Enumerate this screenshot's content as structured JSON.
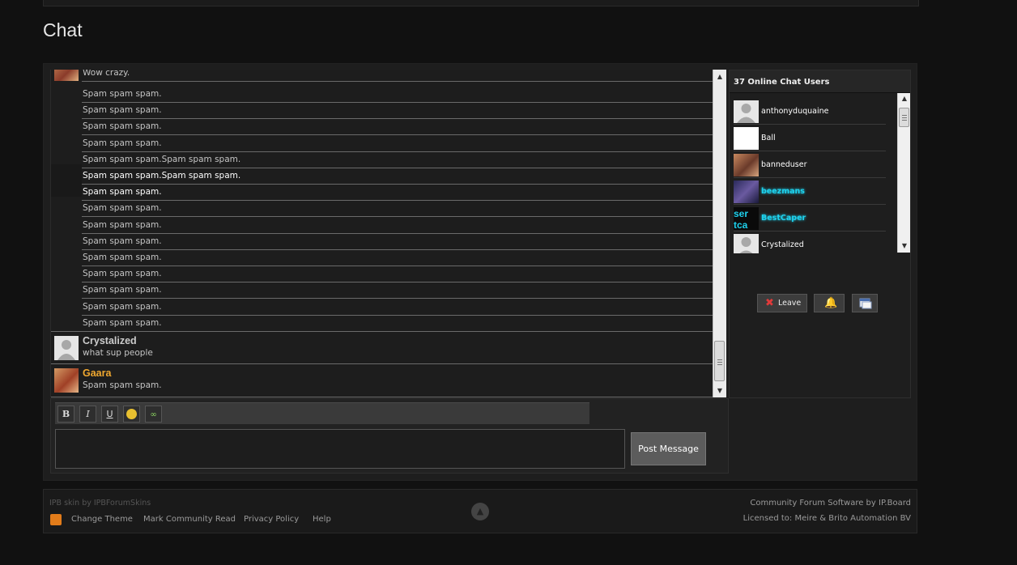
{
  "page": {
    "title": "Chat"
  },
  "messages": {
    "partial_top": "Wow crazy.",
    "lines": [
      "Spam spam spam.",
      "Spam spam spam.",
      "Spam spam spam.",
      "Spam spam spam.",
      "Spam spam spam.Spam spam spam.",
      "Spam spam spam.Spam spam spam.",
      "Spam spam spam.",
      "Spam spam spam.",
      "Spam spam spam.",
      "Spam spam spam.",
      "Spam spam spam.",
      "Spam spam spam.",
      "Spam spam spam.",
      "Spam spam spam.",
      "Spam spam spam."
    ],
    "blocks": [
      {
        "name": "Crystalized",
        "text": "what sup people",
        "name_color": "#cccccc"
      },
      {
        "name": "Gaara",
        "text": "Spam spam spam.",
        "name_color": "#f0a830"
      }
    ]
  },
  "users": {
    "header": "37 Online Chat Users",
    "list": [
      {
        "name": "anthonyduquaine",
        "avatar": "default-avatar-icon"
      },
      {
        "name": "Ball",
        "avatar": "white-avatar-icon"
      },
      {
        "name": "banneduser",
        "avatar": "photo-avatar-icon"
      },
      {
        "name": "beezmans",
        "avatar": "purple-avatar-icon",
        "moderator": true
      },
      {
        "name": "BestCaper",
        "avatar": "cyan-text-avatar-icon",
        "moderator": true
      },
      {
        "name": "Crystalized",
        "avatar": "default-avatar-icon"
      }
    ],
    "moderator_color": "#1ed2ee"
  },
  "panel_buttons": {
    "leave": "Leave"
  },
  "composer": {
    "bold": "B",
    "italic": "I",
    "underline": "U",
    "post_label": "Post Message"
  },
  "footer": {
    "credit": "IPB skin by IPBForumSkins",
    "links": [
      "Change Theme",
      "Mark Community Read",
      "Privacy Policy",
      "Help"
    ],
    "software": "Community Forum Software by IP.Board",
    "licensed": "Licensed to: Meire & Brito Automation BV"
  },
  "colors": {
    "background": "#111111",
    "panel": "#1e1e1e",
    "accent_orange": "#f0a830"
  }
}
